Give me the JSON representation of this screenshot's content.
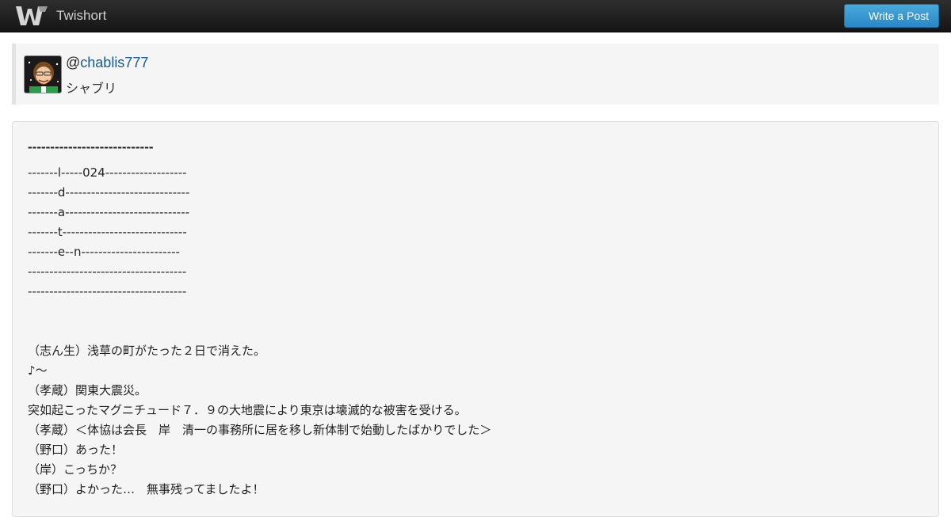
{
  "navbar": {
    "brand": "Twishort",
    "write_button": "Write a Post"
  },
  "user": {
    "at": "@",
    "handle": "chablis777",
    "display_name": "シャブリ"
  },
  "post": {
    "title": "----------------------------",
    "lines": [
      "-------l-----024-------------------",
      "-------d-----------------------------",
      "-------a-----------------------------",
      "-------t-----------------------------",
      "-------e--n-----------------------",
      "-------------------------------------",
      "-------------------------------------",
      "",
      "",
      "（志ん生）浅草の町がたった２日で消えた。",
      "♪～",
      "（孝蔵）関東大震災。",
      "突如起こったマグニチュード７．９の大地震により東京は壊滅的な被害を受ける。",
      "（孝蔵）＜体協は会長　岸　清一の事務所に居を移し新体制で始動したばかりでした＞",
      "（野口）あった！",
      "（岸）こっちか？",
      "（野口）よかった…　無事残ってましたよ！"
    ]
  }
}
